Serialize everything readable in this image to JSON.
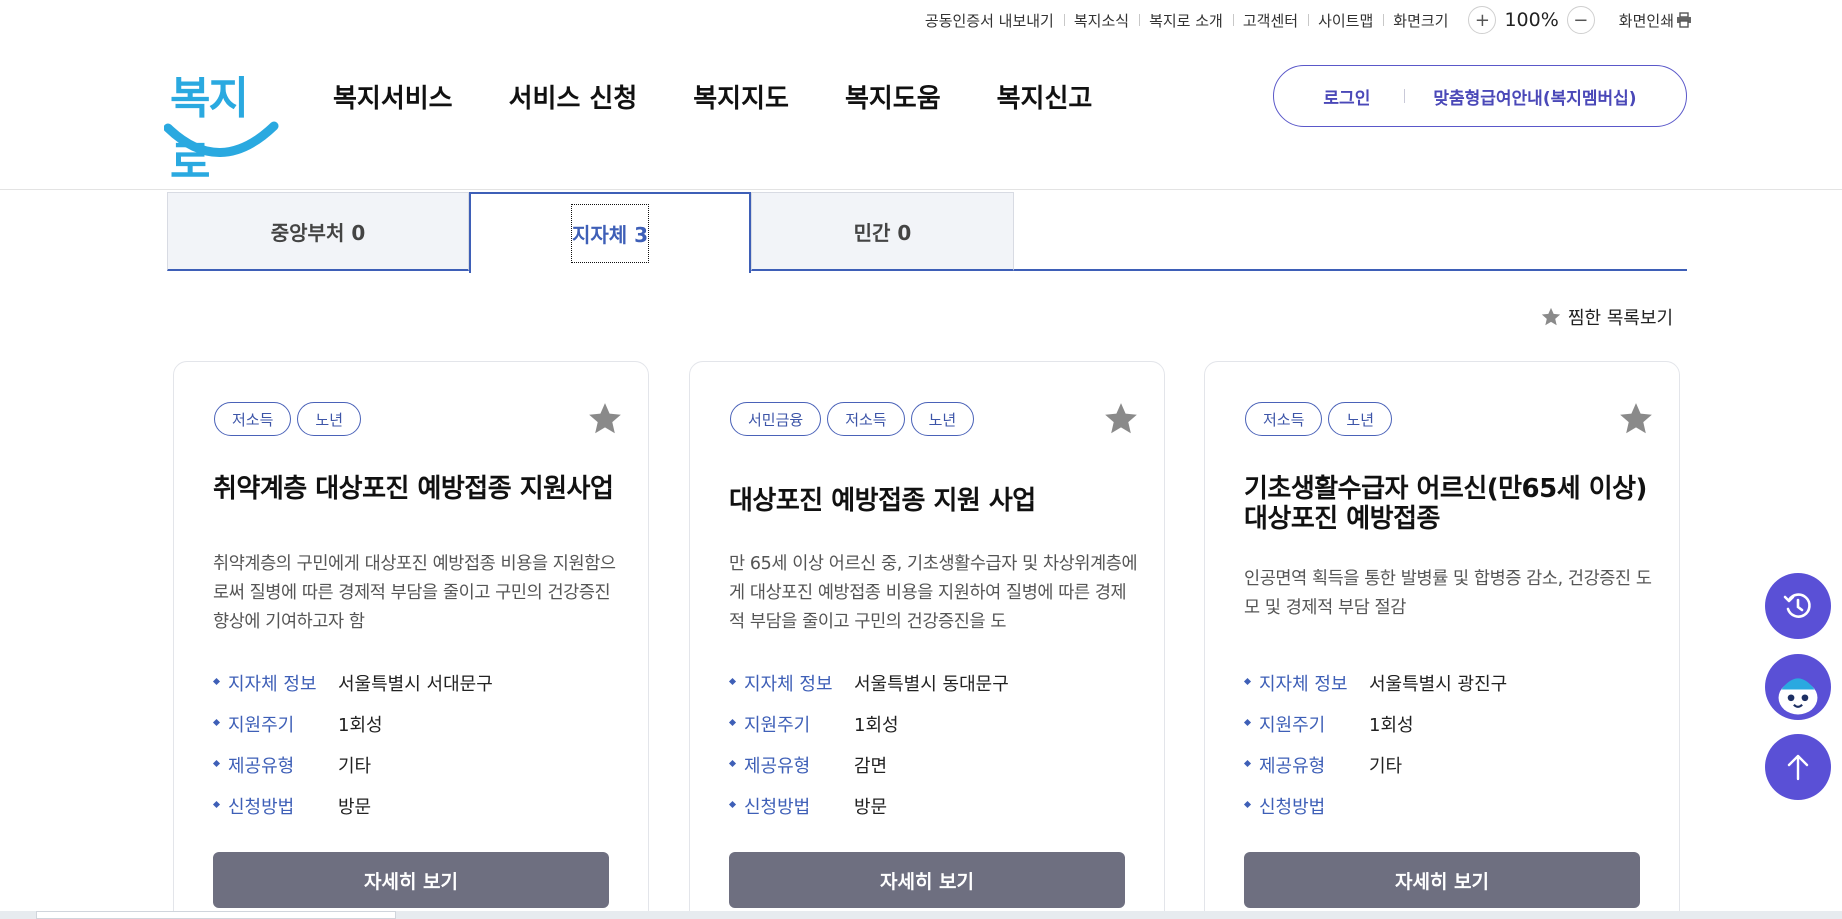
{
  "util": {
    "links": [
      "공동인증서 내보내기",
      "복지소식",
      "복지로 소개",
      "고객센터",
      "사이트맵",
      "화면크기"
    ],
    "zoom_plus": "+",
    "zoom_value": "100%",
    "zoom_minus": "−",
    "print_label": "화면인쇄"
  },
  "logo": {
    "text": "복지로"
  },
  "gnb": [
    "복지서비스",
    "서비스 신청",
    "복지지도",
    "복지도움",
    "복지신고"
  ],
  "member": {
    "login": "로그인",
    "custom": "맞춤형급여안내(복지멤버십)"
  },
  "tabs": [
    {
      "label": "중앙부처 0"
    },
    {
      "label": "지자체 3"
    },
    {
      "label": "민간 0"
    }
  ],
  "favorites_link": "찜한 목록보기",
  "info_keys": [
    "지자체 정보",
    "지원주기",
    "제공유형",
    "신청방법"
  ],
  "cards": [
    {
      "tags": [
        "저소득",
        "노년"
      ],
      "title": "취약계층 대상포진 예방접종 지원사업",
      "desc": "취약계층의 구민에게 대상포진 예방접종 비용을 지원함으로써 질병에 따른 경제적 부담을 줄이고 구민의 건강증진 향상에 기여하고자 함",
      "values": [
        "서울특별시 서대문구",
        "1회성",
        "기타",
        "방문"
      ],
      "button": "자세히 보기"
    },
    {
      "tags": [
        "서민금융",
        "저소득",
        "노년"
      ],
      "title": "대상포진 예방접종 지원 사업",
      "desc": "만 65세 이상 어르신 중, 기초생활수급자 및 차상위계층에게 대상포진 예방접종 비용을 지원하여 질병에 따른 경제적 부담을 줄이고 구민의 건강증진을 도",
      "values": [
        "서울특별시 동대문구",
        "1회성",
        "감면",
        "방문"
      ],
      "button": "자세히 보기"
    },
    {
      "tags": [
        "저소득",
        "노년"
      ],
      "title": "기초생활수급자  어르신(만65세  이상) 대상포진 예방접종",
      "desc": "인공면역 획득을 통한 발병률 및 합병증 감소, 건강증진 도모 및 경제적 부담 절감",
      "values": [
        "서울특별시 광진구",
        "1회성",
        "기타",
        ""
      ],
      "button": "자세히 보기"
    }
  ],
  "colors": {
    "accent": "#3e5fb7",
    "member": "#5a58c9",
    "button": "#6e6f80",
    "float": "#5a50d6",
    "logo": "#2aa9e0"
  },
  "icons": [
    "star-icon",
    "print-icon",
    "history-icon",
    "chatbot-icon",
    "arrow-up-icon"
  ]
}
